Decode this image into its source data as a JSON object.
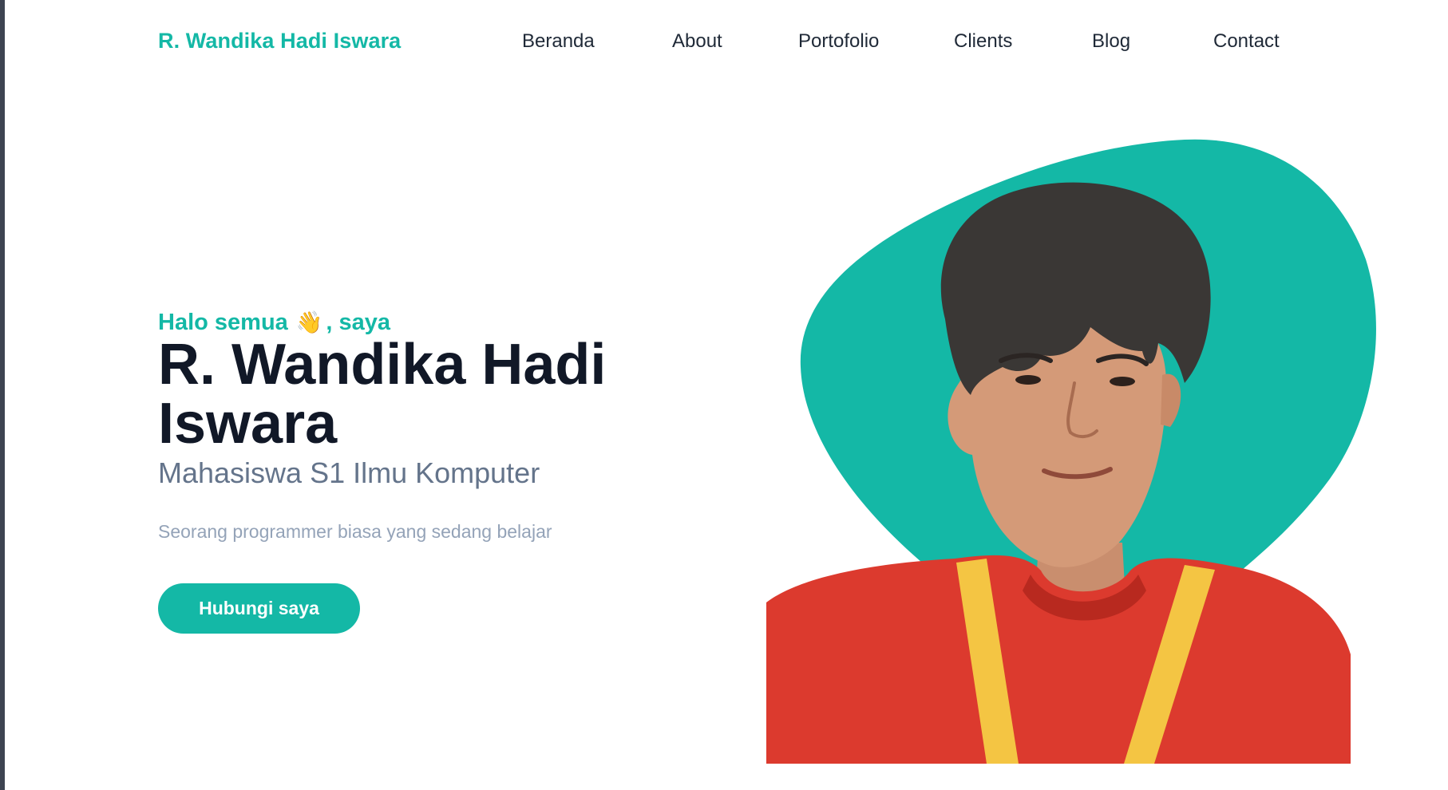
{
  "navbar": {
    "brand": "R. Wandika Hadi Iswara",
    "links": [
      "Beranda",
      "About",
      "Portofolio",
      "Clients",
      "Blog",
      "Contact"
    ]
  },
  "hero": {
    "greeting_prefix": "Halo semua",
    "greeting_emoji": "👋",
    "greeting_suffix": ", saya",
    "name": "R. Wandika Hadi Iswara",
    "role": "Mahasiswa S1 Ilmu Komputer",
    "tagline": "Seorang programmer biasa yang sedang belajar",
    "cta_label": "Hubungi saya"
  },
  "colors": {
    "accent": "#14b8a6",
    "heading": "#111827",
    "muted": "#64748b",
    "light_muted": "#94a3b8",
    "shirt": "#dc3a2e",
    "lanyard": "#f4c543"
  },
  "icons": {
    "wave": "waving-hand-icon"
  }
}
